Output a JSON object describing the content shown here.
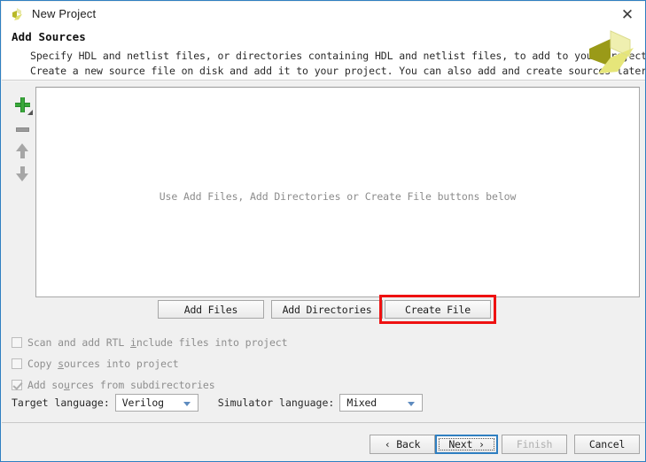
{
  "window": {
    "title": "New Project",
    "icon": "vivado-icon",
    "close_label": "✕"
  },
  "header": {
    "title": "Add Sources",
    "desc_line1": "Specify HDL and netlist files, or directories containing HDL and netlist files, to add to your project.",
    "desc_line2": "Create a new source file on disk and add it to your project. You can also add and create sources later.",
    "logo": "vivado-logo"
  },
  "toolstrip": {
    "add_icon": "add-plus-icon",
    "remove_icon": "remove-minus-icon",
    "move_up_icon": "arrow-up-icon",
    "move_down_icon": "arrow-down-icon"
  },
  "file_list": {
    "placeholder": "Use Add Files, Add Directories or Create File buttons below",
    "items": []
  },
  "actions": {
    "add_files": "Add Files",
    "add_directories": "Add Directories",
    "create_file": "Create File",
    "highlight_color": "#ee1111",
    "highlighted": "create_file"
  },
  "options": {
    "scan_rtl": {
      "label_pre": "Scan and add RTL ",
      "label_mn": "i",
      "label_post": "nclude files into project",
      "checked": false,
      "enabled": false
    },
    "copy_sources": {
      "label_pre": "Copy ",
      "label_mn": "s",
      "label_post": "ources into project",
      "checked": false,
      "enabled": false
    },
    "add_subdirs": {
      "label_pre": "Add so",
      "label_mn": "u",
      "label_post": "rces from subdirectories",
      "checked": true,
      "enabled": false
    }
  },
  "languages": {
    "target_label": "Target language:",
    "target_value": "Verilog",
    "simulator_label": "Simulator language:",
    "simulator_value": "Mixed"
  },
  "footer": {
    "back": "‹ Back",
    "next": "Next ›",
    "finish": "Finish",
    "cancel": "Cancel",
    "focused": "next",
    "disabled": "finish",
    "focus_color": "#2f7fc1"
  }
}
